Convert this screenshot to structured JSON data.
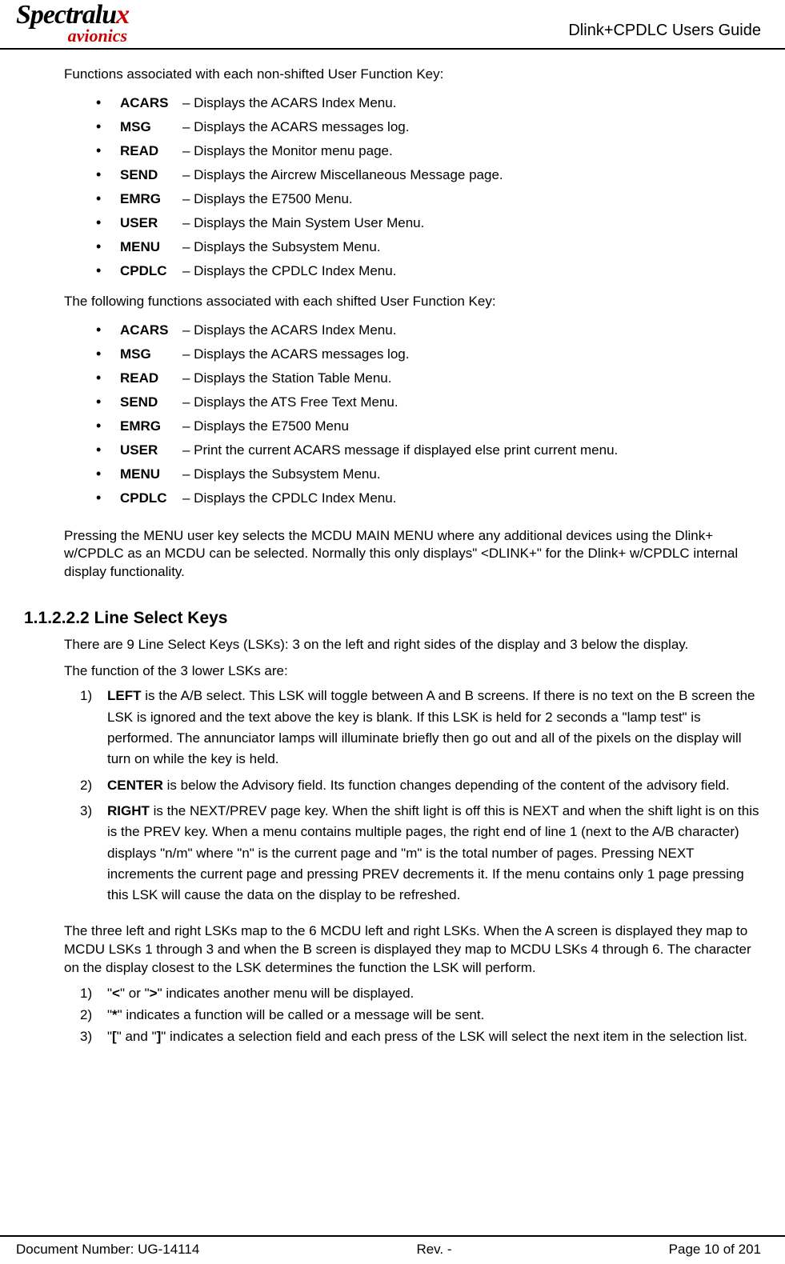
{
  "header": {
    "logo_top_a": "Spectralu",
    "logo_top_b": "x",
    "logo_bottom": "avionics",
    "title": "Dlink+CPDLC Users Guide"
  },
  "body": {
    "intro1": "Functions associated with each non-shifted User Function Key:",
    "list1": [
      {
        "key": "ACARS",
        "desc": "– Displays the ACARS Index Menu."
      },
      {
        "key": "MSG",
        "desc": "– Displays the ACARS messages log."
      },
      {
        "key": "READ",
        "desc": "– Displays the Monitor menu page."
      },
      {
        "key": "SEND",
        "desc": "– Displays the Aircrew Miscellaneous Message page."
      },
      {
        "key": "EMRG",
        "desc": "– Displays the E7500 Menu."
      },
      {
        "key": "USER",
        "desc": "– Displays the Main System User Menu."
      },
      {
        "key": "MENU",
        "desc": "– Displays the Subsystem Menu."
      },
      {
        "key": "CPDLC",
        "desc": "– Displays the CPDLC Index Menu."
      }
    ],
    "intro2": "The following functions associated with each shifted User Function Key:",
    "list2": [
      {
        "key": "ACARS",
        "desc": "– Displays the ACARS Index Menu."
      },
      {
        "key": "MSG",
        "desc": "– Displays the ACARS messages log."
      },
      {
        "key": "READ",
        "desc": "– Displays the Station Table Menu."
      },
      {
        "key": "SEND",
        "desc": "– Displays the ATS Free Text Menu."
      },
      {
        "key": "EMRG",
        "desc": "– Displays the E7500 Menu"
      },
      {
        "key": "USER",
        "desc": "– Print the current ACARS message if displayed else print current menu."
      },
      {
        "key": "MENU",
        "desc": "– Displays the Subsystem Menu."
      },
      {
        "key": "CPDLC",
        "desc": "– Displays the CPDLC Index Menu."
      }
    ],
    "menu_para": "Pressing the MENU user key selects the MCDU MAIN MENU where any additional devices using the Dlink+ w/CPDLC as an MCDU can be selected. Normally this only displays\" <DLINK+\" for the Dlink+ w/CPDLC internal display functionality.",
    "section_heading": "1.1.2.2.2 Line Select Keys",
    "lsk_intro": "There are 9 Line Select Keys (LSKs): 3 on the left and right sides of the display and 3 below the display.",
    "lsk_func_intro": "The function of the 3 lower LSKs are:",
    "lsk_list": [
      {
        "n": "1)",
        "lead": "LEFT",
        "rest": " is the A/B select.  This LSK will toggle between A and B screens.  If there is no text on the B screen the LSK is ignored and the text above the key is blank.  If this LSK is held for 2 seconds a \"lamp test\" is performed.  The annunciator lamps will illuminate briefly then go out and all of the pixels on the display will turn on while the key is held."
      },
      {
        "n": "2)",
        "lead": "CENTER",
        "rest": " is below the Advisory field.  Its function changes depending of the content of the advisory field."
      },
      {
        "n": "3)",
        "lead": "RIGHT",
        "rest": " is the NEXT/PREV page key.  When the shift light is off this is NEXT and when the shift light is on this is the PREV key.  When a menu contains multiple pages, the right end of line 1 (next to the A/B character) displays \"n/m\" where \"n\" is the current page and \"m\" is the total number of pages. Pressing NEXT increments the current page and pressing PREV decrements it.  If the menu contains only 1 page pressing this LSK will cause the data on the display to be refreshed."
      }
    ],
    "lsk_map_para": "The three left and right LSKs map to the 6 MCDU left and right LSKs.   When the A screen is displayed they map to MCDU LSKs 1 through 3 and when the B screen is displayed they map to MCDU LSKs 4 through 6.  The character on the display closest to the LSK determines the function the LSK will perform.",
    "char_list": [
      {
        "n": "1)",
        "pre": " \"",
        "b1": "<",
        "mid": "\" or \"",
        "b2": ">",
        "post": "\" indicates another menu will be displayed."
      },
      {
        "n": "2)",
        "pre": " \"",
        "b1": "*",
        "mid": "",
        "b2": "",
        "post": "\" indicates a function will be called or a message will be sent."
      },
      {
        "n": "3)",
        "pre": "\"",
        "b1": "[",
        "mid": "\" and \"",
        "b2": "]",
        "post": "\" indicates a selection field and each press of the LSK will select the next item in the selection list."
      }
    ]
  },
  "footer": {
    "doc": "Document Number:  UG-14114",
    "rev": "Rev. -",
    "page": "Page 10 of 201"
  }
}
